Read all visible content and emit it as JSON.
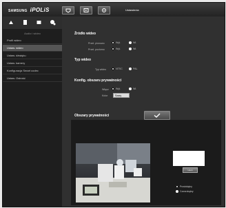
{
  "header": {
    "brand": "SAMSUNG",
    "product": "iPOLiS",
    "setup_label": "Ustawienia"
  },
  "sidebar": {
    "title": "Audio i wideo",
    "items": [
      {
        "label": "Profil wideo",
        "active": false
      },
      {
        "label": "Ustaw. wideo",
        "active": true
      },
      {
        "label": "Ustaw. dźwięku",
        "active": false
      },
      {
        "label": "Ustaw. kamery",
        "active": false
      },
      {
        "label": "Konfiguracja Smart codec",
        "active": false
      },
      {
        "label": "Ustaw. Ostrość",
        "active": false
      }
    ]
  },
  "main": {
    "source_section": "Źródło wideo",
    "flip_vertical_label": "Przeł. pionowo",
    "flip_horizontal_label": "Przeł. poziomo",
    "on_label": "Wył.",
    "off_label": "Wł.",
    "type_section": "Typ wideo",
    "type_label": "Typ wideo",
    "ntsc_label": "NTSC",
    "pal_label": "PAL",
    "privacy_section": "Konfig. obszaru prywatności",
    "enable_label": "Włącz",
    "area_label": "Kolor",
    "area_value": "Szary",
    "privacy_area_section": "Obszary prywatności"
  },
  "panel": {
    "button_label": "Usuń",
    "radio_rect": "Prostokątny",
    "radio_poly": "Czworokątny"
  },
  "colors": {
    "accent": "#555555",
    "background": "#2b2b2b"
  }
}
